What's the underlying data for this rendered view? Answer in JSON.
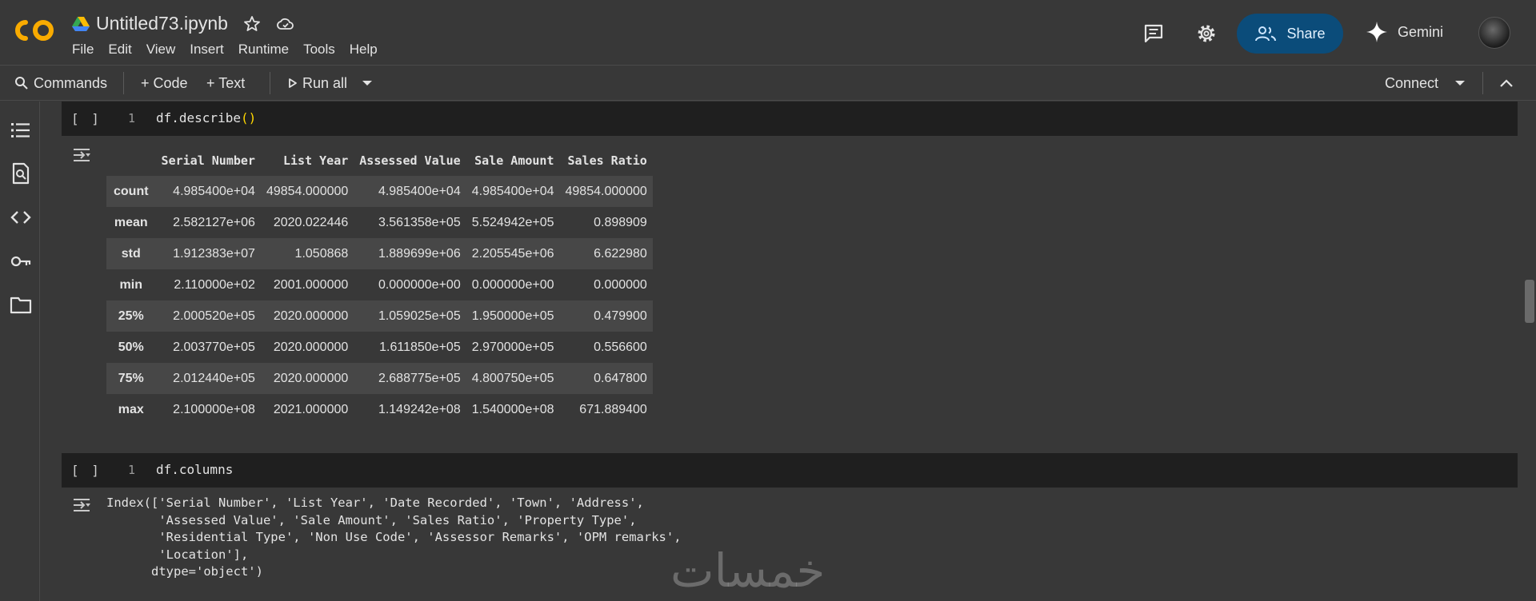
{
  "header": {
    "notebook_title": "Untitled73.ipynb",
    "menu": [
      "File",
      "Edit",
      "View",
      "Insert",
      "Runtime",
      "Tools",
      "Help"
    ],
    "share_label": "Share",
    "gemini_label": "Gemini"
  },
  "toolbar": {
    "commands_label": "Commands",
    "code_label": "+ Code",
    "text_label": "+ Text",
    "run_all_label": "Run all",
    "connect_label": "Connect"
  },
  "cells": [
    {
      "bracket": "[ ]",
      "line_number": "1",
      "code_prefix": "df.describe",
      "code_parens": "()",
      "output_table": {
        "columns": [
          "",
          "Serial Number",
          "List Year",
          "Assessed Value",
          "Sale Amount",
          "Sales Ratio"
        ],
        "rows": [
          [
            "count",
            "4.985400e+04",
            "49854.000000",
            "4.985400e+04",
            "4.985400e+04",
            "49854.000000"
          ],
          [
            "mean",
            "2.582127e+06",
            "2020.022446",
            "3.561358e+05",
            "5.524942e+05",
            "0.898909"
          ],
          [
            "std",
            "1.912383e+07",
            "1.050868",
            "1.889699e+06",
            "2.205545e+06",
            "6.622980"
          ],
          [
            "min",
            "2.110000e+02",
            "2001.000000",
            "0.000000e+00",
            "0.000000e+00",
            "0.000000"
          ],
          [
            "25%",
            "2.000520e+05",
            "2020.000000",
            "1.059025e+05",
            "1.950000e+05",
            "0.479900"
          ],
          [
            "50%",
            "2.003770e+05",
            "2020.000000",
            "1.611850e+05",
            "2.970000e+05",
            "0.556600"
          ],
          [
            "75%",
            "2.012440e+05",
            "2020.000000",
            "2.688775e+05",
            "4.800750e+05",
            "0.647800"
          ],
          [
            "max",
            "2.100000e+08",
            "2021.000000",
            "1.149242e+08",
            "1.540000e+08",
            "671.889400"
          ]
        ]
      }
    },
    {
      "bracket": "[ ]",
      "line_number": "1",
      "code": "df.columns",
      "output_text": "Index(['Serial Number', 'List Year', 'Date Recorded', 'Town', 'Address',\n       'Assessed Value', 'Sale Amount', 'Sales Ratio', 'Property Type',\n       'Residential Type', 'Non Use Code', 'Assessor Remarks', 'OPM remarks',\n       'Location'],\n      dtype='object')"
    }
  ],
  "watermark": "خمسات",
  "icons": {
    "logo": "colab-logo",
    "drive": "google-drive-icon",
    "star": "star-icon",
    "cloud": "cloud-saved-icon",
    "comment": "comment-icon",
    "settings": "gear-icon",
    "share": "people-icon",
    "gemini": "gemini-sparkle-icon",
    "rail": [
      "table-of-contents-icon",
      "find-icon",
      "code-snippets-icon",
      "secrets-key-icon",
      "files-folder-icon"
    ],
    "output": "output-toggle-icon"
  },
  "colors": {
    "background": "#383838",
    "cell_background": "#1f1f1f",
    "share_button": "#0b4c7a",
    "row_stripe": "#474747",
    "logo_orange": "#f9ab00",
    "paren_yellow": "#ffd700"
  }
}
